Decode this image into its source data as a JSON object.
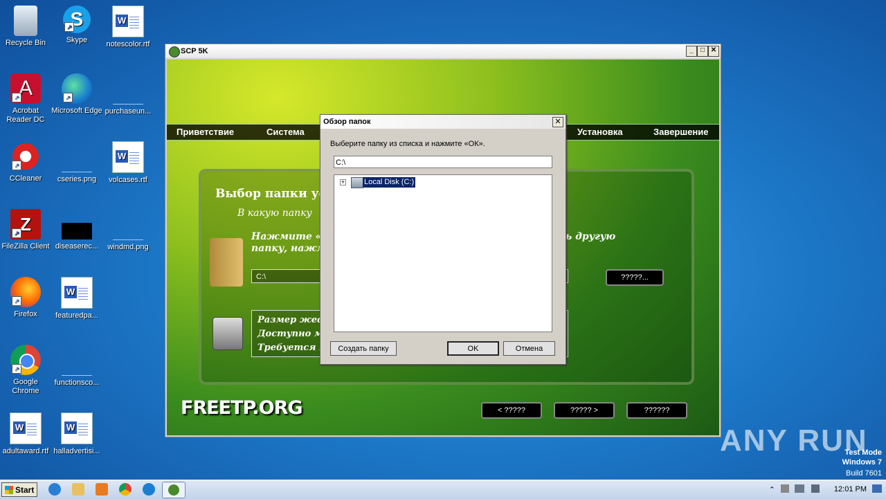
{
  "desktop": {
    "icons": [
      {
        "label": "Recycle Bin",
        "icon": "recycle-bin-icon"
      },
      {
        "label": "Skype",
        "icon": "skype-icon"
      },
      {
        "label": "notescolor.rtf",
        "icon": "word-doc-icon"
      },
      {
        "label": "Acrobat Reader DC",
        "icon": "acrobat-icon"
      },
      {
        "label": "Microsoft Edge",
        "icon": "edge-icon"
      },
      {
        "label": "purchaseun...",
        "icon": "blank-file-icon"
      },
      {
        "label": "CCleaner",
        "icon": "ccleaner-icon"
      },
      {
        "label": "cseries.png",
        "icon": "blank-file-icon"
      },
      {
        "label": "volcases.rtf",
        "icon": "word-doc-icon"
      },
      {
        "label": "FileZilla Client",
        "icon": "filezilla-icon"
      },
      {
        "label": "diseaserec...",
        "icon": "black-thumbnail-icon"
      },
      {
        "label": "windmd.png",
        "icon": "blank-file-icon"
      },
      {
        "label": "Firefox",
        "icon": "firefox-icon"
      },
      {
        "label": "featuredpa...",
        "icon": "word-doc-icon"
      },
      {
        "label": "Google Chrome",
        "icon": "chrome-icon"
      },
      {
        "label": "functionsco...",
        "icon": "blank-file-icon"
      },
      {
        "label": "adultaward.rtf",
        "icon": "word-doc-icon"
      },
      {
        "label": "halladvertisi...",
        "icon": "word-doc-icon"
      }
    ]
  },
  "main_window": {
    "title": "SCP 5K",
    "nav": [
      "Приветствие",
      "Система",
      "Установка",
      "Завершение"
    ],
    "heading": "Выбор папки ус",
    "question": "В какую папку",
    "hint_line1": "Нажмите «Д                                                        выбрать другую",
    "hint_line2": "папку, нажм",
    "path_value": "C:\\",
    "browse_label": "?????...",
    "info_line1": "Размер жест",
    "info_line2": "Доступно ме",
    "info_line3": "Требуется м",
    "logo": "FREETP.ORG",
    "back_label": "< ?????",
    "next_label": "????? >",
    "cancel_label": "??????"
  },
  "dialog": {
    "title": "Обзор папок",
    "close": "✕",
    "instruction": "Выберите папку из списка и нажмите «ОК».",
    "path_value": "C:\\",
    "tree_item": "Local Disk (C:)",
    "new_folder_label": "Создать папку",
    "ok_label": "OK",
    "cancel_label": "Отмена"
  },
  "taskbar": {
    "start_label": "Start",
    "time": "12:01 PM"
  },
  "watermark": {
    "brand": "ANY RUN",
    "mode": "Test Mode",
    "os": "Windows 7",
    "build": "Build 7601"
  }
}
